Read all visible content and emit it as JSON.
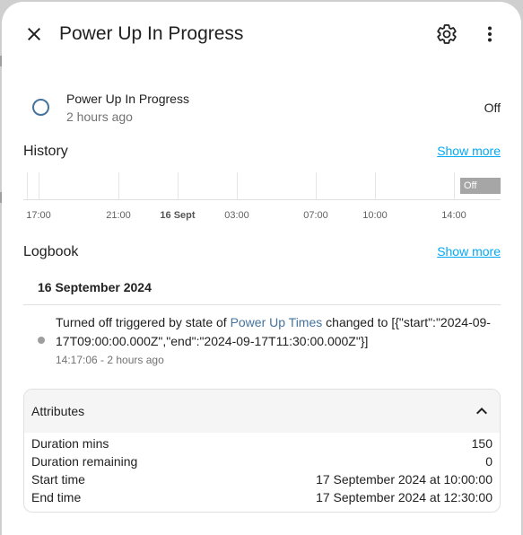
{
  "dialog": {
    "title": "Power Up In Progress"
  },
  "icons": {
    "close": "close-icon",
    "settings": "gear-icon",
    "more": "more-vertical-icon",
    "chevron": "chevron-up-icon"
  },
  "entity": {
    "name": "Power Up In Progress",
    "last_changed": "2 hours ago",
    "state": "Off"
  },
  "history": {
    "title": "History",
    "show_more": "Show more",
    "bar_label": "Off",
    "tick_labels": [
      "17:00",
      "21:00",
      "16 Sept",
      "03:00",
      "07:00",
      "10:00",
      "14:00"
    ]
  },
  "logbook": {
    "title": "Logbook",
    "show_more": "Show more",
    "date": "16 September 2024",
    "entry": {
      "message_prefix": "Turned off triggered by state of ",
      "link": "Power Up Times",
      "message_suffix": " changed to [{\"start\":\"2024-09-17T09:00:00.000Z\",\"end\":\"2024-09-17T11:30:00.000Z\"}]",
      "time": "14:17:06 - 2 hours ago"
    }
  },
  "attributes": {
    "title": "Attributes",
    "rows": [
      {
        "name": "Duration mins",
        "value": "150"
      },
      {
        "name": "Duration remaining",
        "value": "0"
      },
      {
        "name": "Start time",
        "value": "17 September 2024 at 10:00:00"
      },
      {
        "name": "End time",
        "value": "17 September 2024 at 12:30:00"
      }
    ]
  },
  "colors": {
    "accent_link": "#03a9f4",
    "state_icon": "#44739e",
    "off_bar": "#a6a6a6"
  }
}
